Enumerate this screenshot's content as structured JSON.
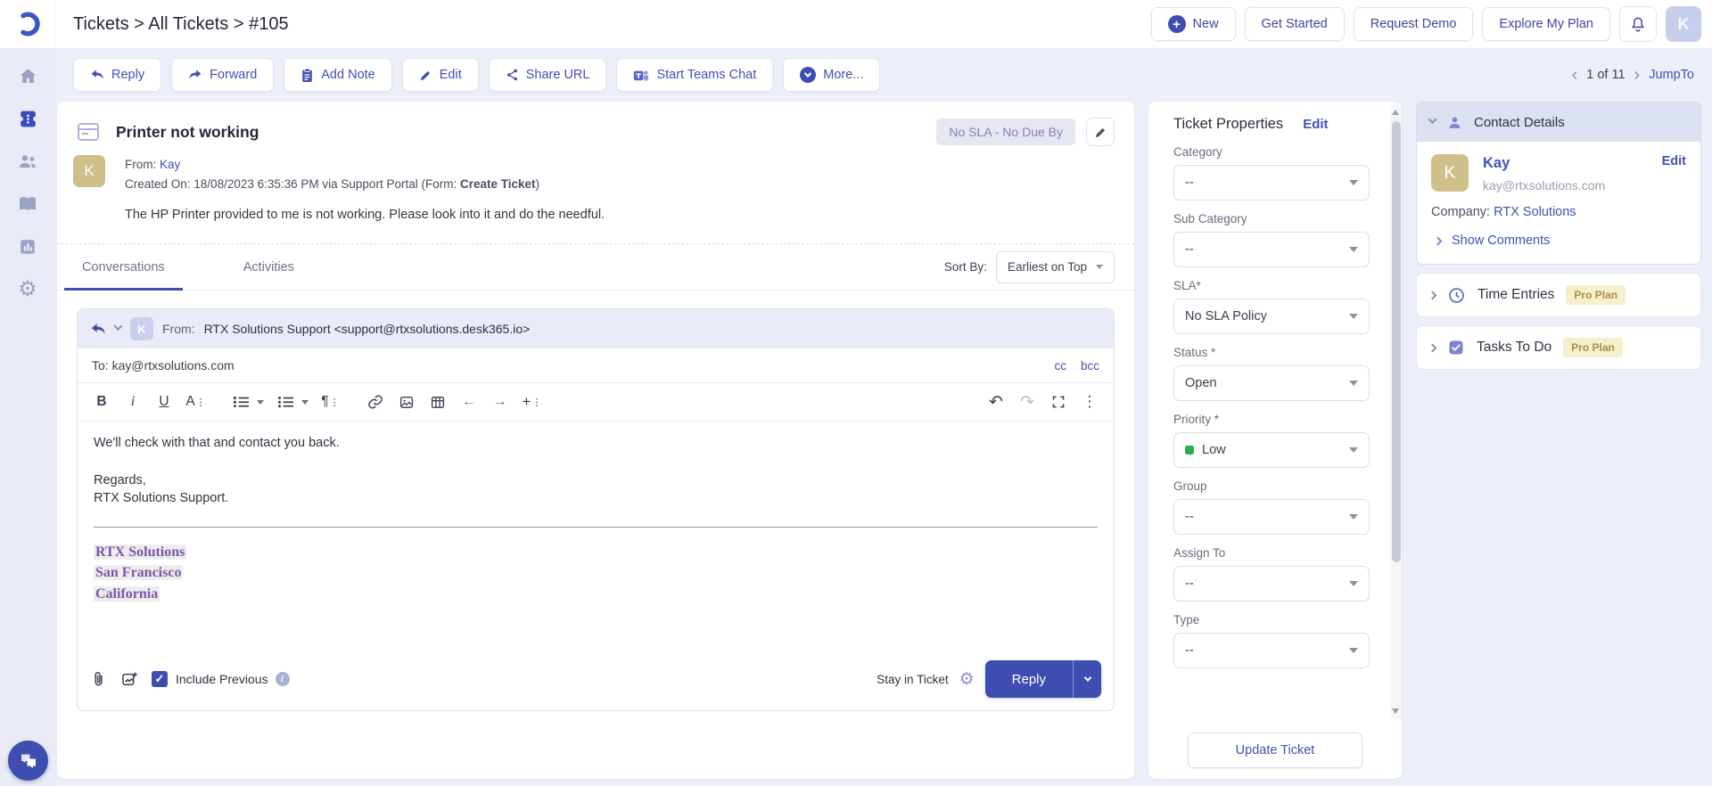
{
  "header": {
    "breadcrumb": "Tickets > All Tickets > #105",
    "new_label": "New",
    "get_started_label": "Get Started",
    "request_demo_label": "Request Demo",
    "explore_plan_label": "Explore My Plan",
    "avatar_initial": "K"
  },
  "toolbar": {
    "reply_label": "Reply",
    "forward_label": "Forward",
    "add_note_label": "Add Note",
    "edit_label": "Edit",
    "share_url_label": "Share URL",
    "teams_chat_label": "Start Teams Chat",
    "more_label": "More...",
    "pagination": "1 of 11",
    "jumpto_label": "JumpTo"
  },
  "ticket": {
    "title": "Printer not working",
    "sla_badge": "No SLA - No Due By",
    "avatar_initial": "K",
    "from_label": "From:",
    "from_name": "Kay",
    "created_prefix": "Created On: 18/08/2023 6:35:36 PM via Support Portal (Form: ",
    "created_bold": "Create Ticket",
    "created_suffix": ")",
    "body": "The HP Printer provided to me is not working. Please look into it and do the needful."
  },
  "tabs": {
    "conversations": "Conversations",
    "activities": "Activities",
    "sort_label": "Sort By:",
    "sort_value": "Earliest on Top"
  },
  "compose": {
    "from_label": "From:",
    "from_value": "RTX Solutions Support <support@rtxsolutions.desk365.io>",
    "avatar_initial": "K",
    "to_label": "To: kay@rtxsolutions.com",
    "cc_label": "cc",
    "bcc_label": "bcc",
    "body_line1": "We'll check with that and contact you back.",
    "body_line2": "Regards,",
    "body_line3": "RTX Solutions Support.",
    "signature": [
      "RTX Solutions",
      "San Francisco",
      "California"
    ],
    "include_previous_label": "Include Previous",
    "stay_in_ticket_label": "Stay in Ticket",
    "reply_label": "Reply"
  },
  "properties": {
    "title": "Ticket Properties",
    "edit_label": "Edit",
    "fields": [
      {
        "label": "Category",
        "value": "--"
      },
      {
        "label": "Sub Category",
        "value": "--"
      },
      {
        "label": "SLA*",
        "value": "No SLA Policy"
      },
      {
        "label": "Status *",
        "value": "Open"
      },
      {
        "label": "Priority *",
        "value": "Low"
      },
      {
        "label": "Group",
        "value": "--"
      },
      {
        "label": "Assign To",
        "value": "--"
      },
      {
        "label": "Type",
        "value": "--"
      }
    ],
    "update_label": "Update Ticket"
  },
  "contact": {
    "title": "Contact Details",
    "avatar_initial": "K",
    "name": "Kay",
    "edit_label": "Edit",
    "email": "kay@rtxsolutions.com",
    "company_label": "Company: ",
    "company_name": "RTX Solutions",
    "show_comments_label": "Show Comments"
  },
  "extra_panels": [
    {
      "title": "Time Entries",
      "badge": "Pro Plan"
    },
    {
      "title": "Tasks To Do",
      "badge": "Pro Plan"
    }
  ],
  "icons": {
    "plus": "+",
    "bold": "B",
    "italic": "i",
    "underline": "U",
    "font": "A",
    "paragraph": "¶",
    "arrow_left": "←",
    "arrow_right": "→",
    "kebab": "⋮",
    "undo": "↶",
    "redo": "↷",
    "check": "✓",
    "info": "i",
    "gear": "⚙",
    "chevron_left": "‹",
    "chevron_right": "›"
  },
  "colors": {
    "primary": "#3d4eb0",
    "priority_low_dot": "#27b04b",
    "signature_text": "#7d57a8",
    "pro_badge_bg": "#f6efce",
    "pro_badge_text": "#a98e3e"
  }
}
